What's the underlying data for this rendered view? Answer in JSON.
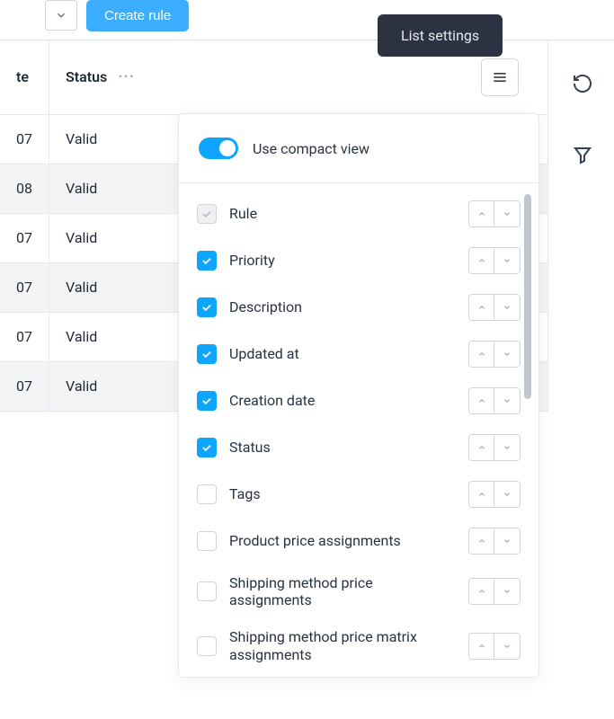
{
  "toolbar": {
    "create_label": "Create rule"
  },
  "tooltip": {
    "text": "List settings"
  },
  "table": {
    "headers": {
      "date": "te",
      "status": "Status"
    },
    "rows": [
      {
        "date": "07",
        "status": "Valid"
      },
      {
        "date": "08",
        "status": "Valid"
      },
      {
        "date": "07",
        "status": "Valid"
      },
      {
        "date": "07",
        "status": "Valid"
      },
      {
        "date": "07",
        "status": "Valid"
      },
      {
        "date": "07",
        "status": "Valid"
      }
    ]
  },
  "popover": {
    "compact_label": "Use compact view",
    "compact_on": true,
    "items": [
      {
        "label": "Rule",
        "state": "locked"
      },
      {
        "label": "Priority",
        "state": "checked"
      },
      {
        "label": "Description",
        "state": "checked"
      },
      {
        "label": "Updated at",
        "state": "checked"
      },
      {
        "label": "Creation date",
        "state": "checked"
      },
      {
        "label": "Status",
        "state": "checked"
      },
      {
        "label": "Tags",
        "state": "unchecked"
      },
      {
        "label": "Product price assignments",
        "state": "unchecked"
      },
      {
        "label": "Shipping method price assignments",
        "state": "unchecked"
      },
      {
        "label": "Shipping method price matrix assignments",
        "state": "unchecked"
      }
    ]
  }
}
